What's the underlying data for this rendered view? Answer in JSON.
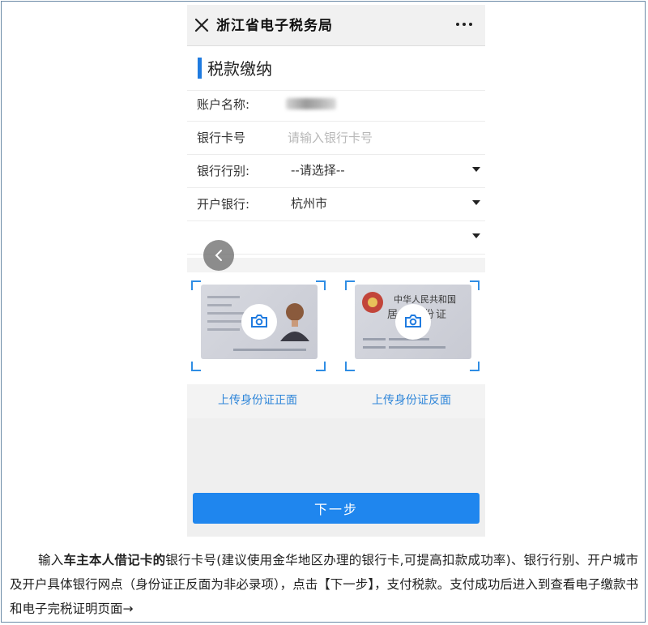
{
  "titlebar": {
    "close_icon": "close-icon",
    "title": "浙江省电子税务局",
    "more_icon": "more-icon"
  },
  "section": {
    "title": "税款缴纳"
  },
  "form": {
    "account_name_label": "账户名称:",
    "bank_card_label": "银行卡号",
    "bank_card_placeholder": "请输入银行卡号",
    "bank_type_label": "银行行别:",
    "bank_type_value": "--请选择--",
    "open_bank_label": "开户银行:",
    "open_bank_value": "杭州市"
  },
  "upload": {
    "front_label": "上传身份证正面",
    "back_label": "上传身份证反面",
    "back_card_title": "中华人民共和国",
    "back_card_subtitle": "居民身份证"
  },
  "actions": {
    "next_label": "下一步"
  },
  "caption": {
    "part1": "输入",
    "bold": "车主本人借记卡的",
    "part2": "银行卡号(建议使用金华地区办理的银行卡,可提高扣款成功率)、银行行别、开户城市及开户具体银行网点（身份证正反面为非必录项），点击【下一步】，支付税款。支付成功后进入到查看电子缴款书和电子完税证明页面→"
  },
  "colors": {
    "accent": "#1f86ee",
    "link": "#2f86d9",
    "section_bar": "#1f7be0"
  }
}
